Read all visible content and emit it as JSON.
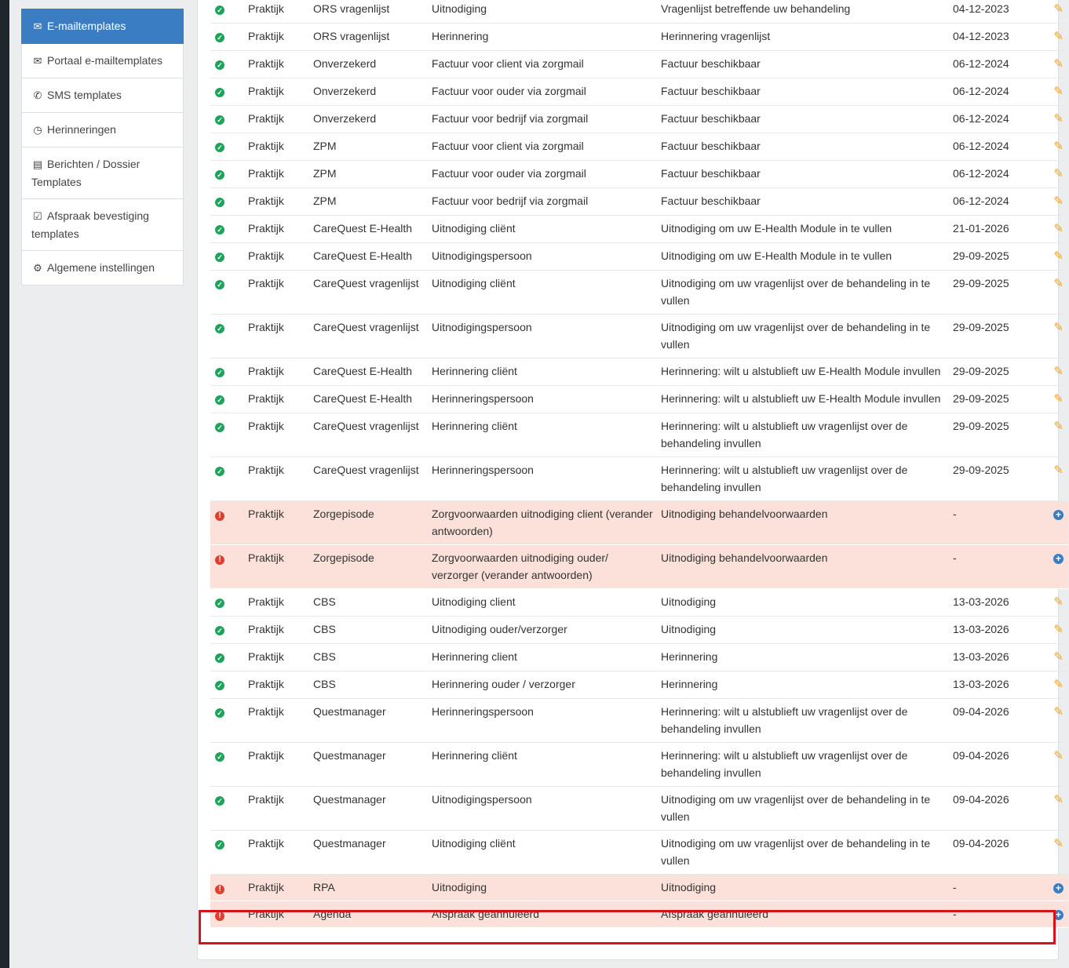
{
  "sidebar": {
    "items": [
      {
        "icon": "envelope-icon",
        "glyph": "✉",
        "label": "E-mailtemplates",
        "active": true
      },
      {
        "icon": "envelope-icon",
        "glyph": "✉",
        "label": "Portaal e-mailtemplates",
        "active": false
      },
      {
        "icon": "phone-icon",
        "glyph": "✆",
        "label": "SMS templates",
        "active": false
      },
      {
        "icon": "clock-icon",
        "glyph": "◷",
        "label": "Herinneringen",
        "active": false
      },
      {
        "icon": "document-icon",
        "glyph": "▤",
        "label": "Berichten / Dossier Templates",
        "active": false
      },
      {
        "icon": "calendar-check-icon",
        "glyph": "☑",
        "label": "Afspraak bevestiging templates",
        "active": false
      },
      {
        "icon": "gear-icon",
        "glyph": "⚙",
        "label": "Algemene instellingen",
        "active": false
      }
    ]
  },
  "table": {
    "rows": [
      {
        "status": "ok",
        "scope": "Praktijk",
        "module": "ORS vragenlijst",
        "template": "Uitnodiging",
        "subject": "Vragenlijst betreffende uw behandeling",
        "date": "04-12-2023",
        "action": "edit"
      },
      {
        "status": "ok",
        "scope": "Praktijk",
        "module": "ORS vragenlijst",
        "template": "Herinnering",
        "subject": "Herinnering vragenlijst",
        "date": "04-12-2023",
        "action": "edit"
      },
      {
        "status": "ok",
        "scope": "Praktijk",
        "module": "Onverzekerd",
        "template": "Factuur voor client via zorgmail",
        "subject": "Factuur beschikbaar",
        "date": "06-12-2024",
        "action": "edit"
      },
      {
        "status": "ok",
        "scope": "Praktijk",
        "module": "Onverzekerd",
        "template": "Factuur voor ouder via zorgmail",
        "subject": "Factuur beschikbaar",
        "date": "06-12-2024",
        "action": "edit"
      },
      {
        "status": "ok",
        "scope": "Praktijk",
        "module": "Onverzekerd",
        "template": "Factuur voor bedrijf via zorgmail",
        "subject": "Factuur beschikbaar",
        "date": "06-12-2024",
        "action": "edit"
      },
      {
        "status": "ok",
        "scope": "Praktijk",
        "module": "ZPM",
        "template": "Factuur voor client via zorgmail",
        "subject": "Factuur beschikbaar",
        "date": "06-12-2024",
        "action": "edit"
      },
      {
        "status": "ok",
        "scope": "Praktijk",
        "module": "ZPM",
        "template": "Factuur voor ouder via zorgmail",
        "subject": "Factuur beschikbaar",
        "date": "06-12-2024",
        "action": "edit"
      },
      {
        "status": "ok",
        "scope": "Praktijk",
        "module": "ZPM",
        "template": "Factuur voor bedrijf via zorgmail",
        "subject": "Factuur beschikbaar",
        "date": "06-12-2024",
        "action": "edit"
      },
      {
        "status": "ok",
        "scope": "Praktijk",
        "module": "CareQuest E-Health",
        "template": "Uitnodiging cliënt",
        "subject": "Uitnodiging om uw E-Health Module in te vullen",
        "date": "21-01-2026",
        "action": "edit"
      },
      {
        "status": "ok",
        "scope": "Praktijk",
        "module": "CareQuest E-Health",
        "template": "Uitnodigingspersoon",
        "subject": "Uitnodiging om uw E-Health Module in te vullen",
        "date": "29-09-2025",
        "action": "edit"
      },
      {
        "status": "ok",
        "scope": "Praktijk",
        "module": "CareQuest vragenlijst",
        "template": "Uitnodiging cliënt",
        "subject": "Uitnodiging om uw vragenlijst over de behandeling in te vullen",
        "date": "29-09-2025",
        "action": "edit"
      },
      {
        "status": "ok",
        "scope": "Praktijk",
        "module": "CareQuest vragenlijst",
        "template": "Uitnodigingspersoon",
        "subject": "Uitnodiging om uw vragenlijst over de behandeling in te vullen",
        "date": "29-09-2025",
        "action": "edit"
      },
      {
        "status": "ok",
        "scope": "Praktijk",
        "module": "CareQuest E-Health",
        "template": "Herinnering cliënt",
        "subject": "Herinnering: wilt u alstublieft uw E-Health Module invullen",
        "date": "29-09-2025",
        "action": "edit"
      },
      {
        "status": "ok",
        "scope": "Praktijk",
        "module": "CareQuest E-Health",
        "template": "Herinneringspersoon",
        "subject": "Herinnering: wilt u alstublieft uw E-Health Module invullen",
        "date": "29-09-2025",
        "action": "edit"
      },
      {
        "status": "ok",
        "scope": "Praktijk",
        "module": "CareQuest vragenlijst",
        "template": "Herinnering cliënt",
        "subject": "Herinnering: wilt u alstublieft uw vragenlijst over de behandeling invullen",
        "date": "29-09-2025",
        "action": "edit"
      },
      {
        "status": "ok",
        "scope": "Praktijk",
        "module": "CareQuest vragenlijst",
        "template": "Herinneringspersoon",
        "subject": "Herinnering: wilt u alstublieft uw vragenlijst over de behandeling invullen",
        "date": "29-09-2025",
        "action": "edit"
      },
      {
        "status": "missing",
        "scope": "Praktijk",
        "module": "Zorgepisode",
        "template": "Zorgvoorwaarden uitnodiging client (verander antwoorden)",
        "subject": "Uitnodiging behandelvoorwaarden",
        "date": "-",
        "action": "add"
      },
      {
        "status": "missing",
        "scope": "Praktijk",
        "module": "Zorgepisode",
        "template": "Zorgvoorwaarden uitnodiging ouder/ verzorger (verander antwoorden)",
        "subject": "Uitnodiging behandelvoorwaarden",
        "date": "-",
        "action": "add"
      },
      {
        "status": "ok",
        "scope": "Praktijk",
        "module": "CBS",
        "template": "Uitnodiging client",
        "subject": "Uitnodiging",
        "date": "13-03-2026",
        "action": "edit"
      },
      {
        "status": "ok",
        "scope": "Praktijk",
        "module": "CBS",
        "template": "Uitnodiging ouder/verzorger",
        "subject": "Uitnodiging",
        "date": "13-03-2026",
        "action": "edit"
      },
      {
        "status": "ok",
        "scope": "Praktijk",
        "module": "CBS",
        "template": "Herinnering client",
        "subject": "Herinnering",
        "date": "13-03-2026",
        "action": "edit"
      },
      {
        "status": "ok",
        "scope": "Praktijk",
        "module": "CBS",
        "template": "Herinnering ouder / verzorger",
        "subject": "Herinnering",
        "date": "13-03-2026",
        "action": "edit"
      },
      {
        "status": "ok",
        "scope": "Praktijk",
        "module": "Questmanager",
        "template": "Herinneringspersoon",
        "subject": "Herinnering: wilt u alstublieft uw vragenlijst over de behandeling invullen",
        "date": "09-04-2026",
        "action": "edit"
      },
      {
        "status": "ok",
        "scope": "Praktijk",
        "module": "Questmanager",
        "template": "Herinnering cliënt",
        "subject": "Herinnering: wilt u alstublieft uw vragenlijst over de behandeling invullen",
        "date": "09-04-2026",
        "action": "edit"
      },
      {
        "status": "ok",
        "scope": "Praktijk",
        "module": "Questmanager",
        "template": "Uitnodigingspersoon",
        "subject": "Uitnodiging om uw vragenlijst over de behandeling in te vullen",
        "date": "09-04-2026",
        "action": "edit"
      },
      {
        "status": "ok",
        "scope": "Praktijk",
        "module": "Questmanager",
        "template": "Uitnodiging cliënt",
        "subject": "Uitnodiging om uw vragenlijst over de behandeling in te vullen",
        "date": "09-04-2026",
        "action": "edit"
      },
      {
        "status": "missing",
        "scope": "Praktijk",
        "module": "RPA",
        "template": "Uitnodiging",
        "subject": "Uitnodiging",
        "date": "-",
        "action": "add"
      },
      {
        "status": "missing",
        "scope": "Praktijk",
        "module": "Agenda",
        "template": "Afspraak geannuleerd",
        "subject": "Afspraak geannuleerd",
        "date": "-",
        "action": "add"
      }
    ]
  },
  "colors": {
    "accent": "#3a7dc2",
    "ok": "#1fa35b",
    "missing": "#d9412e",
    "missing_row_bg": "#fbe1d9",
    "edit": "#f0a322",
    "highlight": "#d6131b"
  }
}
